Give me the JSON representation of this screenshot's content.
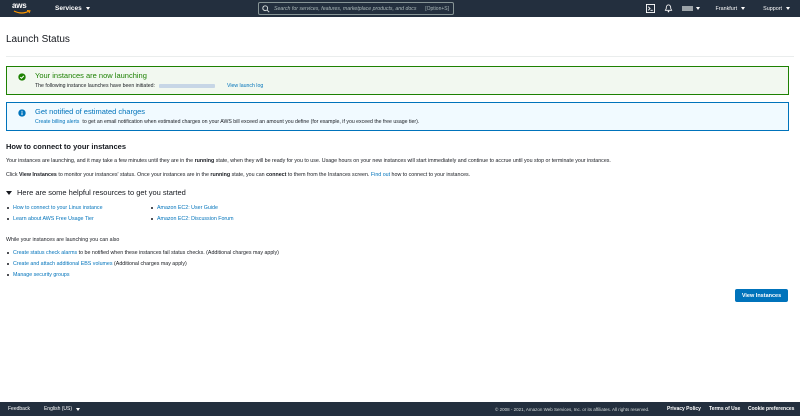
{
  "topnav": {
    "logo": "aws",
    "services_label": "Services",
    "search_placeholder": "Search for services, features, marketplace products, and docs",
    "search_shortcut": "[Option+S]",
    "region": "Frankfurt",
    "support": "Support",
    "icons": [
      "terminal-icon",
      "bell-icon",
      "account-icon"
    ]
  },
  "page": {
    "title": "Launch Status"
  },
  "success_alert": {
    "title": "Your instances are now launching",
    "body_prefix": "The following instance launches have been initiated:",
    "link": "View launch log"
  },
  "info_alert": {
    "title": "Get notified of estimated charges",
    "link": "Create billing alerts",
    "body": "to get an email notification when estimated charges on your AWS bill exceed an amount you define (for example, if you exceed the free usage tier)."
  },
  "connect": {
    "heading": "How to connect to your instances",
    "p1_a": "Your instances are launching, and it may take a few minutes until they are in the",
    "p1_b": "running",
    "p1_c": "state, when they will be ready for you to use. Usage hours on your new instances will start immediately and continue to accrue until you stop or terminate your instances.",
    "p2_a": "Click",
    "p2_b": "View Instances",
    "p2_c": "to monitor your instances' status. Once your instances are in the",
    "p2_d": "running",
    "p2_e": "state, you can",
    "p2_f": "connect",
    "p2_g": "to them from the Instances screen.",
    "p2_link": "Find out",
    "p2_h": "how to connect to your instances."
  },
  "resources": {
    "heading": "Here are some helpful resources to get you started",
    "left": [
      "How to connect to your Linux instance",
      "Learn about AWS Free Usage Tier"
    ],
    "right": [
      "Amazon EC2: User Guide",
      "Amazon EC2: Discussion Forum"
    ]
  },
  "also": {
    "intro": "While your instances are launching you can also",
    "items": [
      {
        "link": "Create status check alarms",
        "text": "to be notified when these instances fail status checks. (Additional charges may apply)"
      },
      {
        "link": "Create and attach additional EBS volumes",
        "text": "(Additional charges may apply)"
      },
      {
        "link": "Manage security groups",
        "text": ""
      }
    ]
  },
  "button": {
    "view_instances": "View Instances"
  },
  "footer": {
    "feedback": "Feedback",
    "language": "English (US)",
    "copyright": "© 2008 - 2021, Amazon Web Services, Inc. or its affiliates. All rights reserved.",
    "privacy": "Privacy Policy",
    "terms": "Terms of Use",
    "cookies": "Cookie preferences"
  },
  "colors": {
    "nav_bg": "#232f3e",
    "success": "#1d8102",
    "info": "#0073bb",
    "link": "#0073bb",
    "primary_button": "#0073bb"
  }
}
